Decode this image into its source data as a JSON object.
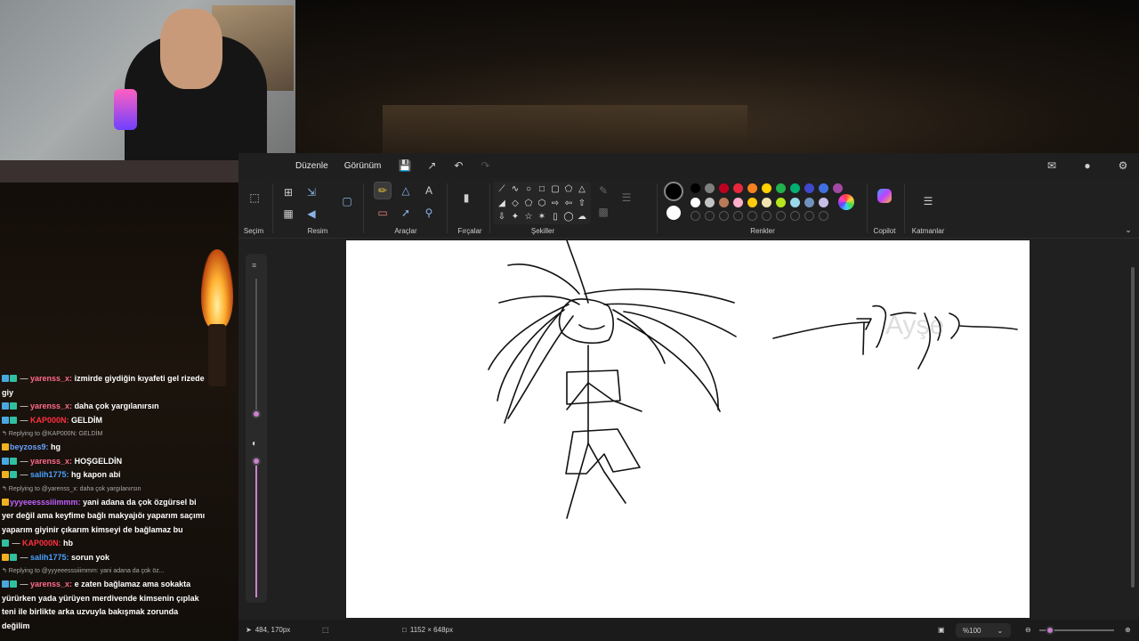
{
  "app": {
    "menu": [
      "Düzenle",
      "Görünüm"
    ],
    "groups": {
      "selection": "Seçim",
      "image": "Resim",
      "tools": "Araçlar",
      "brushes": "Fırçalar",
      "shapes": "Şekiller",
      "colors": "Renkler",
      "copilot": "Copilot",
      "layers": "Katmanlar"
    },
    "colors": {
      "current_primary": "#000000",
      "current_secondary": "#ffffff",
      "palette_row1": [
        "#000000",
        "#7f7f7f",
        "#c00020",
        "#e8283c",
        "#f58220",
        "#ffd200",
        "#22b14c",
        "#00b070",
        "#3f48cc",
        "#4070e0",
        "#a349a4"
      ],
      "palette_row2": [
        "#ffffff",
        "#c3c3c3",
        "#b97a57",
        "#ffaec9",
        "#ffc90e",
        "#efe4b0",
        "#b5e61d",
        "#99d9ea",
        "#7092be",
        "#c8bfe7"
      ]
    },
    "status": {
      "cursor": "484, 170px",
      "size": "1152 × 648px",
      "zoom": "%100"
    },
    "canvas_text": "Ayşe"
  },
  "chat": [
    {
      "type": "msg",
      "badges": "bg",
      "user": "yarenss_x",
      "color": "#ff6a8a",
      "dash": true,
      "text": "izmirde giydiğin kıyafeti gel rizede giy"
    },
    {
      "type": "msg",
      "badges": "bg",
      "user": "yarenss_x",
      "color": "#ff6a8a",
      "dash": true,
      "text": "daha çok yargılanırsın"
    },
    {
      "type": "msg",
      "badges": "bg",
      "user": "KAP000N",
      "color": "#ff3040",
      "dash": true,
      "text": "GELDİM"
    },
    {
      "type": "reply",
      "text": "Replying to @KAP000N: GELDİM"
    },
    {
      "type": "msg",
      "badges": "y",
      "user": "beyzoss9",
      "color": "#6aa0ff",
      "dash": false,
      "text": "hg"
    },
    {
      "type": "msg",
      "badges": "bg",
      "user": "yarenss_x",
      "color": "#ff6a8a",
      "dash": true,
      "text": "HOŞGELDİN"
    },
    {
      "type": "msg",
      "badges": "yg",
      "user": "salih1775",
      "color": "#4aa0ff",
      "dash": true,
      "text": "hg kapon abi"
    },
    {
      "type": "reply",
      "text": "Replying to @yarenss_x: daha çok yargılanırsın"
    },
    {
      "type": "msg",
      "badges": "y",
      "user": "yyyeeesssiiimmm",
      "color": "#c060ff",
      "dash": false,
      "text": "yani adana da çok özgürsel bi yer değil ama keyfime bağlı makyajıöı yaparım saçımı yaparım giyinir çıkarım kimseyi de bağlamaz bu"
    },
    {
      "type": "msg",
      "badges": "g",
      "user": "KAP000N",
      "color": "#ff3040",
      "dash": true,
      "text": "hb"
    },
    {
      "type": "msg",
      "badges": "yg",
      "user": "salih1775",
      "color": "#4aa0ff",
      "dash": true,
      "text": "sorun yok"
    },
    {
      "type": "reply",
      "text": "Replying to @yyyeeesssiiimmm: yani adana da çok öz..."
    },
    {
      "type": "msg",
      "badges": "bg",
      "user": "yarenss_x",
      "color": "#ff6a8a",
      "dash": true,
      "text": "e zaten bağlamaz ama sokakta yürürken yada yürüyen merdivende kimsenin çıplak teni ile birlikte arka uzvuyla bakışmak zorunda değilim"
    }
  ]
}
